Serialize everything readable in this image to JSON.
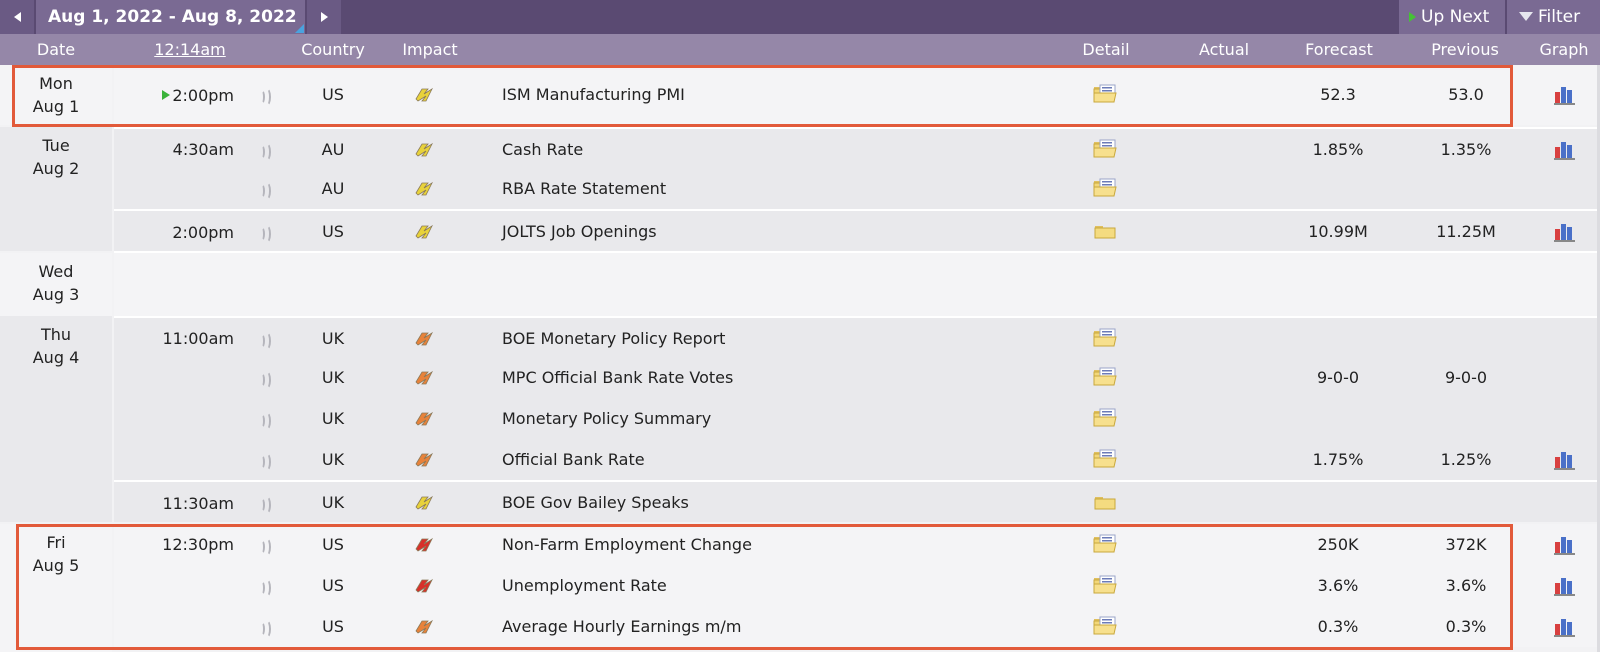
{
  "toolbar": {
    "date_range": "Aug 1, 2022 - Aug 8, 2022",
    "up_next_label": "Up Next",
    "filter_label": "Filter"
  },
  "header": {
    "date": "Date",
    "time": "12:14am",
    "country": "Country",
    "impact": "Impact",
    "detail": "Detail",
    "actual": "Actual",
    "forecast": "Forecast",
    "previous": "Previous",
    "graph": "Graph"
  },
  "days": [
    {
      "day": "Mon",
      "date": "Aug 1"
    },
    {
      "day": "Tue",
      "date": "Aug 2"
    },
    {
      "day": "Wed",
      "date": "Aug 3"
    },
    {
      "day": "Thu",
      "date": "Aug 4"
    },
    {
      "day": "Fri",
      "date": "Aug 5"
    }
  ],
  "events": [
    {
      "time": "2:00pm",
      "country": "US",
      "impact": "yellow",
      "event": "ISM Manufacturing PMI",
      "forecast": "52.3",
      "previous": "53.0",
      "detail_icon": "folder-open-icon",
      "graph": true,
      "up_next": true
    },
    {
      "time": "4:30am",
      "country": "AU",
      "impact": "yellow",
      "event": "Cash Rate",
      "forecast": "1.85%",
      "previous": "1.35%",
      "detail_icon": "folder-open-icon",
      "graph": true
    },
    {
      "time": "",
      "country": "AU",
      "impact": "yellow",
      "event": "RBA Rate Statement",
      "forecast": "",
      "previous": "",
      "detail_icon": "folder-open-icon",
      "graph": false
    },
    {
      "time": "2:00pm",
      "country": "US",
      "impact": "yellow",
      "event": "JOLTS Job Openings",
      "forecast": "10.99M",
      "previous": "11.25M",
      "detail_icon": "folder-closed-icon",
      "graph": true
    },
    {
      "time": "11:00am",
      "country": "UK",
      "impact": "orange",
      "event": "BOE Monetary Policy Report",
      "forecast": "",
      "previous": "",
      "detail_icon": "folder-open-icon",
      "graph": false
    },
    {
      "time": "",
      "country": "UK",
      "impact": "orange",
      "event": "MPC Official Bank Rate Votes",
      "forecast": "9-0-0",
      "previous": "9-0-0",
      "detail_icon": "folder-open-icon",
      "graph": false
    },
    {
      "time": "",
      "country": "UK",
      "impact": "orange",
      "event": "Monetary Policy Summary",
      "forecast": "",
      "previous": "",
      "detail_icon": "folder-open-icon",
      "graph": false
    },
    {
      "time": "",
      "country": "UK",
      "impact": "orange",
      "event": "Official Bank Rate",
      "forecast": "1.75%",
      "previous": "1.25%",
      "detail_icon": "folder-open-icon",
      "graph": true
    },
    {
      "time": "11:30am",
      "country": "UK",
      "impact": "yellow",
      "event": "BOE Gov Bailey Speaks",
      "forecast": "",
      "previous": "",
      "detail_icon": "folder-closed-icon",
      "graph": false
    },
    {
      "time": "12:30pm",
      "country": "US",
      "impact": "red",
      "event": "Non-Farm Employment Change",
      "forecast": "250K",
      "previous": "372K",
      "detail_icon": "folder-open-icon",
      "graph": true
    },
    {
      "time": "",
      "country": "US",
      "impact": "red",
      "event": "Unemployment Rate",
      "forecast": "3.6%",
      "previous": "3.6%",
      "detail_icon": "folder-open-icon",
      "graph": true
    },
    {
      "time": "",
      "country": "US",
      "impact": "orange",
      "event": "Average Hourly Earnings m/m",
      "forecast": "0.3%",
      "previous": "0.3%",
      "detail_icon": "folder-open-icon",
      "graph": true
    }
  ],
  "colors": {
    "impact_yellow": "#e8d23a",
    "impact_orange": "#e8823a",
    "impact_red": "#d8302a",
    "highlight": "#e25a3a"
  }
}
